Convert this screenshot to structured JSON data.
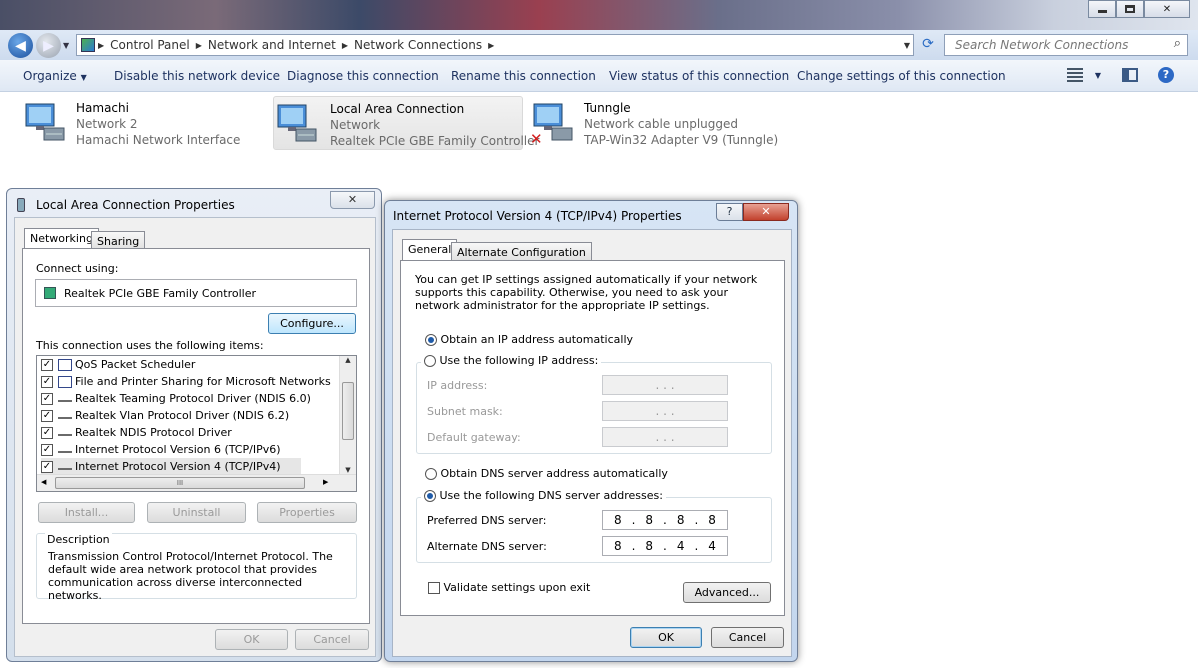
{
  "window": {
    "min_icon": "minimize-icon",
    "max_icon": "maximize-icon",
    "close_glyph": "✕"
  },
  "address": {
    "crumbs": [
      "Control Panel",
      "Network and Internet",
      "Network Connections"
    ],
    "search_placeholder": "Search Network Connections"
  },
  "toolbar": {
    "organize": "Organize",
    "disable": "Disable this network device",
    "diagnose": "Diagnose this connection",
    "rename": "Rename this connection",
    "view_status": "View status of this connection",
    "change_settings": "Change settings of this connection"
  },
  "connections": [
    {
      "name": "Hamachi",
      "status": "Network  2",
      "adapter": "Hamachi Network Interface"
    },
    {
      "name": "Local Area Connection",
      "status": "Network",
      "adapter": "Realtek PCIe GBE Family Controller"
    },
    {
      "name": "Tunngle",
      "status": "Network cable unplugged",
      "adapter": "TAP-Win32 Adapter V9 (Tunngle)"
    }
  ],
  "lac": {
    "title": "Local Area Connection Properties",
    "close_glyph": "✕",
    "tabs": [
      "Networking",
      "Sharing"
    ],
    "connect_using_label": "Connect using:",
    "adapter": "Realtek PCIe GBE Family Controller",
    "configure": "Configure...",
    "items_label": "This connection uses the following items:",
    "items": [
      {
        "label": "QoS Packet Scheduler",
        "checked": true
      },
      {
        "label": "File and Printer Sharing for Microsoft Networks",
        "checked": true
      },
      {
        "label": "Realtek Teaming Protocol Driver (NDIS 6.0)",
        "checked": true
      },
      {
        "label": "Realtek Vlan Protocol Driver (NDIS 6.2)",
        "checked": true
      },
      {
        "label": "Realtek NDIS Protocol Driver",
        "checked": true
      },
      {
        "label": "Internet Protocol Version 6 (TCP/IPv6)",
        "checked": true
      },
      {
        "label": "Internet Protocol Version 4 (TCP/IPv4)",
        "checked": true
      }
    ],
    "hscroll_thumb": "III",
    "install": "Install...",
    "uninstall": "Uninstall",
    "properties": "Properties",
    "description_label": "Description",
    "description": "Transmission Control Protocol/Internet Protocol. The default wide area network protocol that provides communication across diverse interconnected networks.",
    "ok": "OK",
    "cancel": "Cancel"
  },
  "ipv4": {
    "title": "Internet Protocol Version 4 (TCP/IPv4) Properties",
    "help_glyph": "?",
    "close_glyph": "✕",
    "tabs": [
      "General",
      "Alternate Configuration"
    ],
    "intro": "You can get IP settings assigned automatically if your network supports this capability. Otherwise, you need to ask your network administrator for the appropriate IP settings.",
    "obtain_ip": "Obtain an IP address automatically",
    "use_ip": "Use the following IP address:",
    "ip_label": "IP address:",
    "subnet_label": "Subnet mask:",
    "gateway_label": "Default gateway:",
    "empty_ip": ".   .   .",
    "obtain_dns": "Obtain DNS server address automatically",
    "use_dns": "Use the following DNS server addresses:",
    "preferred_label": "Preferred DNS server:",
    "preferred": [
      "8",
      ".",
      "8",
      ".",
      "8",
      ".",
      "8"
    ],
    "alternate_label": "Alternate DNS server:",
    "alternate": [
      "8",
      ".",
      "8",
      ".",
      "4",
      ".",
      "4"
    ],
    "validate": "Validate settings upon exit",
    "advanced": "Advanced...",
    "ok": "OK",
    "cancel": "Cancel"
  }
}
